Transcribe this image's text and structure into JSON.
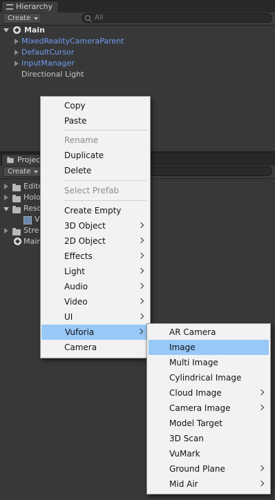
{
  "hierarchy": {
    "tab_label": "Hierarchy",
    "create_label": "Create",
    "search_placeholder": "All",
    "scene_name": "Main",
    "items": [
      {
        "label": "MixedRealityCameraParent",
        "color": "#6f9bf2"
      },
      {
        "label": "DefaultCursor",
        "color": "#6f9bf2"
      },
      {
        "label": "InputManager",
        "color": "#6f9bf2"
      },
      {
        "label": "Directional Light",
        "color": "#c8c8c8"
      }
    ]
  },
  "project": {
    "tab_label": "Projec",
    "create_label": "Create",
    "items": [
      {
        "label": "Edito"
      },
      {
        "label": "Holo"
      },
      {
        "label": "Reso"
      },
      {
        "label": "V"
      },
      {
        "label": "Stre"
      },
      {
        "label": "Main"
      }
    ]
  },
  "context_menu": {
    "copy": "Copy",
    "paste": "Paste",
    "rename": "Rename",
    "duplicate": "Duplicate",
    "delete": "Delete",
    "select_prefab": "Select Prefab",
    "create_empty": "Create Empty",
    "object_3d": "3D Object",
    "object_2d": "2D Object",
    "effects": "Effects",
    "light": "Light",
    "audio": "Audio",
    "video": "Video",
    "ui": "UI",
    "vuforia": "Vuforia",
    "camera": "Camera"
  },
  "vuforia_submenu": {
    "ar_camera": "AR Camera",
    "image": "Image",
    "multi_image": "Multi Image",
    "cylindrical_image": "Cylindrical Image",
    "cloud_image": "Cloud Image",
    "camera_image": "Camera Image",
    "model_target": "Model Target",
    "scan_3d": "3D Scan",
    "vumark": "VuMark",
    "ground_plane": "Ground Plane",
    "mid_air": "Mid Air"
  },
  "colors": {
    "highlight": "#98c8f8",
    "prefab_text": "#6f9bf2",
    "panel_bg": "#383838"
  }
}
